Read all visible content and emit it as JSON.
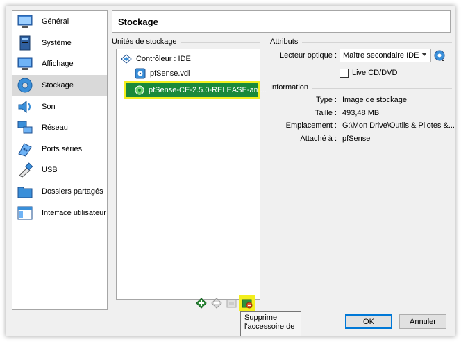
{
  "sidebar": {
    "items": [
      {
        "label": "Général",
        "icon": "general-icon"
      },
      {
        "label": "Système",
        "icon": "system-icon"
      },
      {
        "label": "Affichage",
        "icon": "display-icon"
      },
      {
        "label": "Stockage",
        "icon": "storage-icon",
        "selected": true
      },
      {
        "label": "Son",
        "icon": "audio-icon"
      },
      {
        "label": "Réseau",
        "icon": "network-icon"
      },
      {
        "label": "Ports séries",
        "icon": "serial-ports-icon"
      },
      {
        "label": "USB",
        "icon": "usb-icon"
      },
      {
        "label": "Dossiers partagés",
        "icon": "shared-folders-icon"
      },
      {
        "label": "Interface utilisateur",
        "icon": "user-interface-icon"
      }
    ]
  },
  "page": {
    "title": "Stockage"
  },
  "storage": {
    "group_title": "Unités de stockage",
    "controller": "Contrôleur : IDE",
    "disk": "pfSense.vdi",
    "optical": "pfSense-CE-2.5.0-RELEASE-am..."
  },
  "attributes": {
    "group_title": "Attributs",
    "optical_drive_label": "Lecteur optique :",
    "optical_drive_value": "Maître secondaire IDE",
    "live_cd_label": "Live CD/DVD"
  },
  "information": {
    "group_title": "Information",
    "rows": [
      {
        "key": "Type :",
        "value": "Image de stockage"
      },
      {
        "key": "Taille :",
        "value": "493,48 MB"
      },
      {
        "key": "Emplacement :",
        "value": "G:\\Mon Drive\\Outils & Pilotes &..."
      },
      {
        "key": "Attaché à :",
        "value": "pfSense"
      }
    ]
  },
  "buttons": {
    "ok": "OK",
    "cancel": "Annuler"
  },
  "tooltip": {
    "line1": "Supprime",
    "line2": "l'accessoire de"
  },
  "colors": {
    "highlight": "#f3ef1e",
    "selected_row": "#1a8a3a",
    "accent": "#0078d7"
  }
}
